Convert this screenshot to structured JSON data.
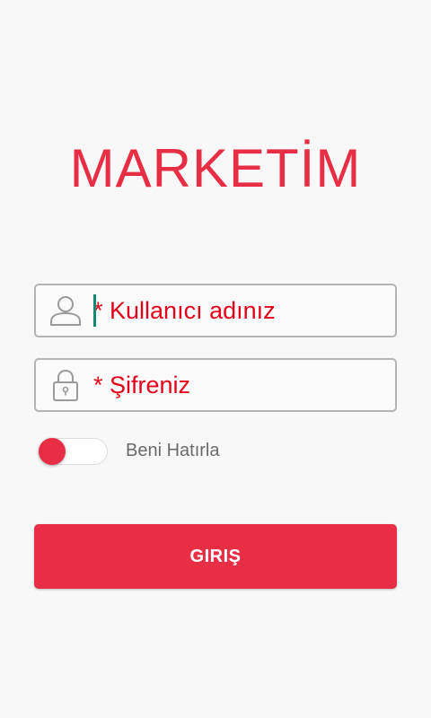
{
  "app": {
    "title": "MARKETİM"
  },
  "login_form": {
    "username": {
      "value": "",
      "placeholder": "* Kullanıcı adınız",
      "icon": "user-icon"
    },
    "password": {
      "value": "",
      "placeholder": "* Şifreniz",
      "icon": "lock-icon"
    },
    "remember_me": {
      "label": "Beni Hatırla",
      "checked": false
    },
    "submit_label": "GIRIŞ"
  },
  "colors": {
    "accent": "#e82e45",
    "placeholder": "#e2001a",
    "caret": "#0f8a72",
    "border": "#b4b4b4",
    "background": "#f8f8f8"
  }
}
